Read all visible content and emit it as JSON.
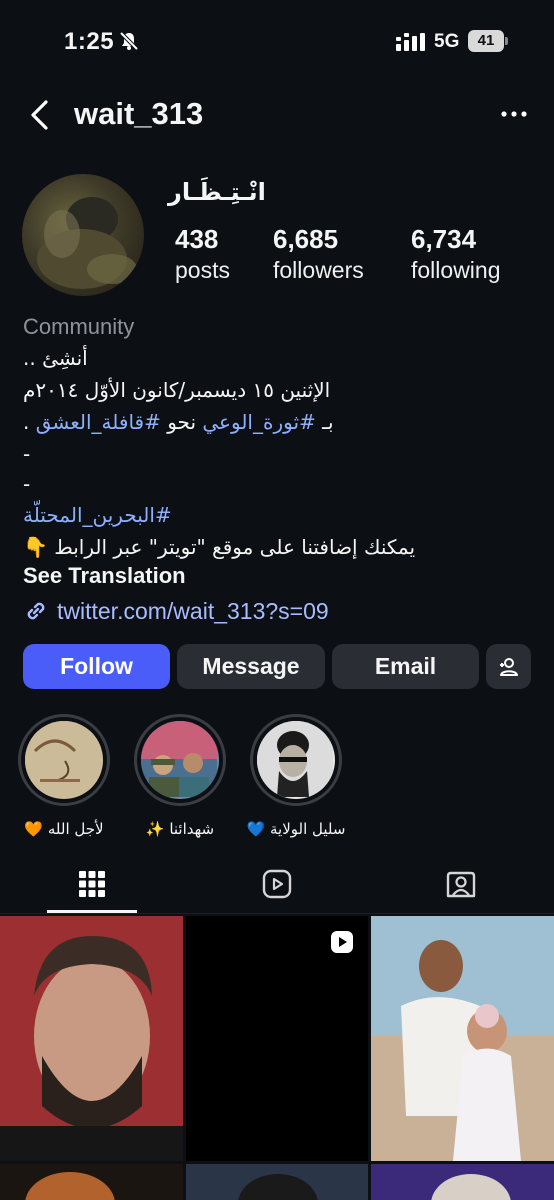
{
  "status_bar": {
    "time": "1:25",
    "network": "5G",
    "battery": "41"
  },
  "header": {
    "username": "wait_313"
  },
  "profile": {
    "display_name": "انْـتِـظَـار",
    "stats": [
      {
        "value": "438",
        "label": "posts"
      },
      {
        "value": "6,685",
        "label": "followers"
      },
      {
        "value": "6,734",
        "label": "following"
      }
    ],
    "category": "Community",
    "bio": {
      "line1": "أنشِئ ..",
      "line2": "الإثنين ١٥ ديسمبر/كانون الأوّل ٢٠١٤م",
      "line3_prefix": "بـ ",
      "line3_tag1": "#ثورة_الوعي",
      "line3_mid": " نحو ",
      "line3_tag2": "#قافلة_العشق",
      "line3_suffix": " .",
      "line4": "-",
      "line5": "-",
      "line6_tag": "#البحرين_المحتلّة",
      "line7": "يمكنك إضافتنا على موقع \"تويتر\" عبر الرابط 👇"
    },
    "see_translation": "See Translation",
    "link": "twitter.com/wait_313?s=09"
  },
  "buttons": {
    "follow": "Follow",
    "message": "Message",
    "email": "Email"
  },
  "highlights": [
    {
      "label": "سليل الولاية 💙"
    },
    {
      "label": "شهدائنا ✨"
    },
    {
      "label": "لأجل الله 🧡"
    }
  ],
  "tabs": [
    "grid-icon",
    "reels-icon",
    "tagged-icon"
  ],
  "colors": {
    "accent": "#4a5df9",
    "link": "#a9bcff",
    "hashtag": "#8fb0ff",
    "background": "#0c0f14"
  }
}
